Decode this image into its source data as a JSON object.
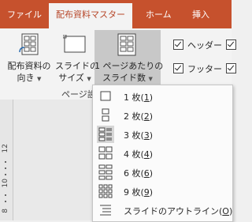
{
  "tabs": {
    "file": "ファイル",
    "handout_master": "配布資料マスター",
    "home": "ホーム",
    "insert": "挿入"
  },
  "ribbon": {
    "handout_orientation": {
      "line1": "配布資料の",
      "line2": "向き"
    },
    "slide_size": {
      "line1": "スライドの",
      "line2": "サイズ"
    },
    "slides_per_page": {
      "line1": "1 ページあたりの",
      "line2": "スライド数"
    },
    "header_label": "ヘッダー",
    "footer_label": "フッター",
    "group_label": "ページ設"
  },
  "ruler": {
    "marks": [
      "12",
      "10",
      "8"
    ]
  },
  "menu": {
    "items": [
      {
        "label": "1 枚(",
        "key": "1",
        "tail": ")",
        "icon": "one-slide-icon"
      },
      {
        "label": "2 枚(",
        "key": "2",
        "tail": ")",
        "icon": "two-slides-icon"
      },
      {
        "label": "3 枚(",
        "key": "3",
        "tail": ")",
        "icon": "three-slides-icon",
        "selected": true
      },
      {
        "label": "4 枚(",
        "key": "4",
        "tail": ")",
        "icon": "four-slides-icon"
      },
      {
        "label": "6 枚(",
        "key": "6",
        "tail": ")",
        "icon": "six-slides-icon"
      },
      {
        "label": "9 枚(",
        "key": "9",
        "tail": ")",
        "icon": "nine-slides-icon"
      },
      {
        "label": "スライドのアウトライン(",
        "key": "O",
        "tail": ")",
        "icon": "outline-icon"
      }
    ]
  },
  "colors": {
    "accent": "#c6512d",
    "active_tab_text": "#b7472a"
  }
}
